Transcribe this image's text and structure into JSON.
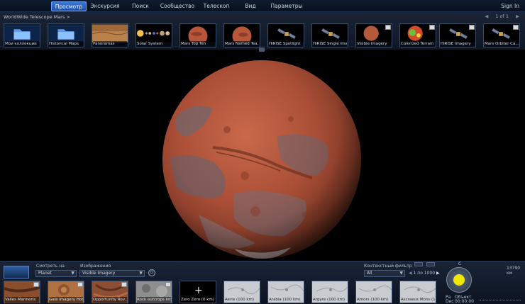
{
  "menu": {
    "items": [
      "Просмотр",
      "Экскурсия",
      "Поиск",
      "Сообщество",
      "Телескоп",
      "Вид",
      "Параметры"
    ],
    "active_index": 0,
    "signin": "Sign In"
  },
  "explore": {
    "breadcrumb": "WorldWide Telescope Mars >",
    "pager": "1 of 1",
    "thumbnails": [
      {
        "label": "Мои коллекции",
        "kind": "folder"
      },
      {
        "label": "Historical Maps",
        "kind": "folder"
      },
      {
        "label": "Panoramas",
        "kind": "panorama"
      },
      {
        "label": "Solar System",
        "kind": "solar"
      },
      {
        "label": "Mars Top Ten",
        "kind": "mars"
      },
      {
        "label": "Mars Named Tea...",
        "kind": "mars"
      },
      {
        "label": "HiRISE Spotlight",
        "kind": "satellite"
      },
      {
        "label": "HiRISE Single Ima...",
        "kind": "satellite"
      },
      {
        "label": "Visible Imagery",
        "kind": "visible"
      },
      {
        "label": "Colorized Terrain",
        "kind": "colorized"
      },
      {
        "label": "HiRISE Imagery",
        "kind": "satellite"
      },
      {
        "label": "Mars Orbiter Ca...",
        "kind": "satellite"
      }
    ]
  },
  "bottom": {
    "look_at_label": "Смотреть на",
    "look_at_value": "Planet",
    "imagery_label": "Изображения",
    "imagery_value": "Visible Imagery",
    "context_filter_label": "Контекстный фильтр",
    "context_filter_value": "All",
    "pager": "1 по 1000",
    "scale": "13790 км",
    "compass_top": "C",
    "footer_left": "Ра",
    "footer_obj": "Объект",
    "footer_dec": "Dec",
    "footer_coord": "00:00:00",
    "thumbnails": [
      {
        "label": "Valles Marineris",
        "kind": "terrain"
      },
      {
        "label": "Gale Imagery Hot...",
        "kind": "crater"
      },
      {
        "label": "Opportunity Rov...",
        "kind": "terrain"
      },
      {
        "label": "Rock outcrops Int...",
        "kind": "gray"
      },
      {
        "label": "Zero Zero (0 km)",
        "kind": "plus"
      },
      {
        "label": "Aerie (100 km)",
        "kind": "sketch"
      },
      {
        "label": "Arabia (100 km)",
        "kind": "sketch"
      },
      {
        "label": "Argyre (100 km)",
        "kind": "sketch"
      },
      {
        "label": "Amors (100 km)",
        "kind": "sketch"
      },
      {
        "label": "Ascraeus Mons (1...",
        "kind": "sketch"
      }
    ]
  },
  "colors": {
    "accent": "#3b78d8",
    "mars": "#b4543a",
    "compass": "#f2e800"
  }
}
